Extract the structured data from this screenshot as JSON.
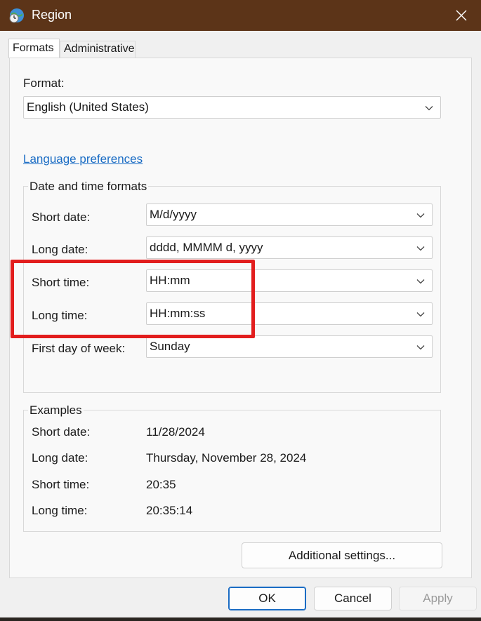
{
  "window": {
    "title": "Region",
    "app_icon": "globe-clock-icon",
    "close_icon": "close-icon"
  },
  "tabs": [
    {
      "label": "Formats",
      "active": true
    },
    {
      "label": "Administrative",
      "active": false
    }
  ],
  "format": {
    "label": "Format:",
    "value": "English (United States)"
  },
  "language_link": "Language preferences",
  "date_time_formats": {
    "title": "Date and time formats",
    "rows": [
      {
        "label": "Short date:",
        "value": "M/d/yyyy"
      },
      {
        "label": "Long date:",
        "value": "dddd, MMMM d, yyyy"
      },
      {
        "label": "Short time:",
        "value": "HH:mm"
      },
      {
        "label": "Long time:",
        "value": "HH:mm:ss"
      },
      {
        "label": "First day of week:",
        "value": "Sunday"
      }
    ]
  },
  "examples": {
    "title": "Examples",
    "rows": [
      {
        "label": "Short date:",
        "value": "11/28/2024"
      },
      {
        "label": "Long date:",
        "value": "Thursday, November 28, 2024"
      },
      {
        "label": "Short time:",
        "value": "20:35"
      },
      {
        "label": "Long time:",
        "value": "20:35:14"
      }
    ]
  },
  "buttons": {
    "additional_settings": "Additional settings...",
    "ok": "OK",
    "cancel": "Cancel",
    "apply": "Apply"
  },
  "colors": {
    "titlebar": "#5c3418",
    "link": "#1a6cc4",
    "highlight": "#e21d1d"
  }
}
